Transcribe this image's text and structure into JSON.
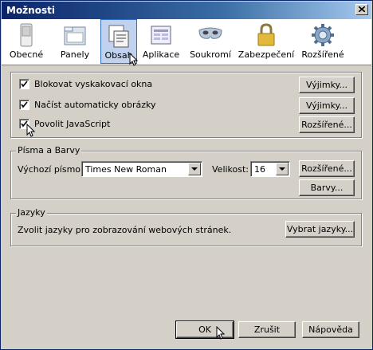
{
  "window": {
    "title": "Možnosti"
  },
  "toolbar": {
    "items": [
      {
        "label": "Obecné",
        "icon": "switch-icon"
      },
      {
        "label": "Panely",
        "icon": "folder-icon"
      },
      {
        "label": "Obsah",
        "icon": "content-icon"
      },
      {
        "label": "Aplikace",
        "icon": "applications-icon"
      },
      {
        "label": "Soukromí",
        "icon": "mask-icon"
      },
      {
        "label": "Zabezpečení",
        "icon": "padlock-icon"
      },
      {
        "label": "Rozšířené",
        "icon": "gear-icon"
      }
    ],
    "active": "Obsah"
  },
  "content": {
    "popups": {
      "label": "Blokovat vyskakovací okna",
      "checked": true,
      "button": "Výjimky..."
    },
    "images": {
      "label": "Načíst automaticky obrázky",
      "checked": true,
      "button": "Výjimky..."
    },
    "javascript": {
      "label": "Povolit JavaScript",
      "checked": true,
      "button": "Rozšířené..."
    }
  },
  "fonts": {
    "legend": "Písma a Barvy",
    "default_font_label": "Výchozí písmo:",
    "default_font_value": "Times New Roman",
    "size_label": "Velikost:",
    "size_value": "16",
    "advanced_button": "Rozšířené...",
    "colors_button": "Barvy..."
  },
  "languages": {
    "legend": "Jazyky",
    "description": "Zvolit jazyky pro zobrazování webových stránek.",
    "button": "Vybrat jazyky..."
  },
  "footer": {
    "ok": "OK",
    "cancel": "Zrušit",
    "help": "Nápověda"
  }
}
